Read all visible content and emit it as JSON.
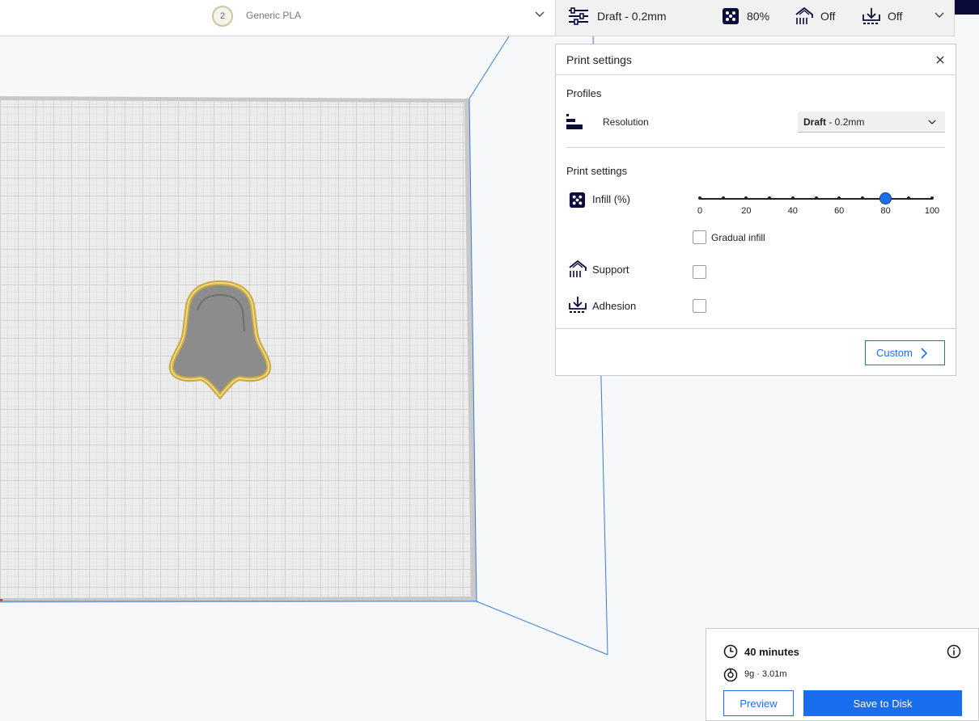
{
  "material": {
    "extruder_number": "2",
    "name": "Generic PLA"
  },
  "summary_bar": {
    "profile": "Draft - 0.2mm",
    "infill": "80%",
    "support": "Off",
    "adhesion": "Off"
  },
  "print_settings": {
    "title": "Print settings",
    "profiles_heading": "Profiles",
    "resolution_label": "Resolution",
    "resolution_value_bold": "Draft",
    "resolution_value_rest": " - 0.2mm",
    "settings_heading": "Print settings",
    "infill_label": "Infill (%)",
    "infill": {
      "value": 80,
      "ticks": [
        "0",
        "20",
        "40",
        "60",
        "80",
        "100"
      ]
    },
    "gradual_infill_label": "Gradual infill",
    "gradual_infill_checked": false,
    "support_label": "Support",
    "support_checked": false,
    "adhesion_label": "Adhesion",
    "adhesion_checked": false,
    "custom_button": "Custom"
  },
  "job": {
    "time": "40 minutes",
    "material_usage": "9g · 3.01m",
    "preview_button": "Preview",
    "save_button": "Save to Disk"
  },
  "colors": {
    "accent": "#196ef0",
    "model_outline": "#e8c763",
    "model_fill": "#8a8a8a",
    "build_plate": "#e4e4e4",
    "bounds_line": "#3a7bd5"
  }
}
